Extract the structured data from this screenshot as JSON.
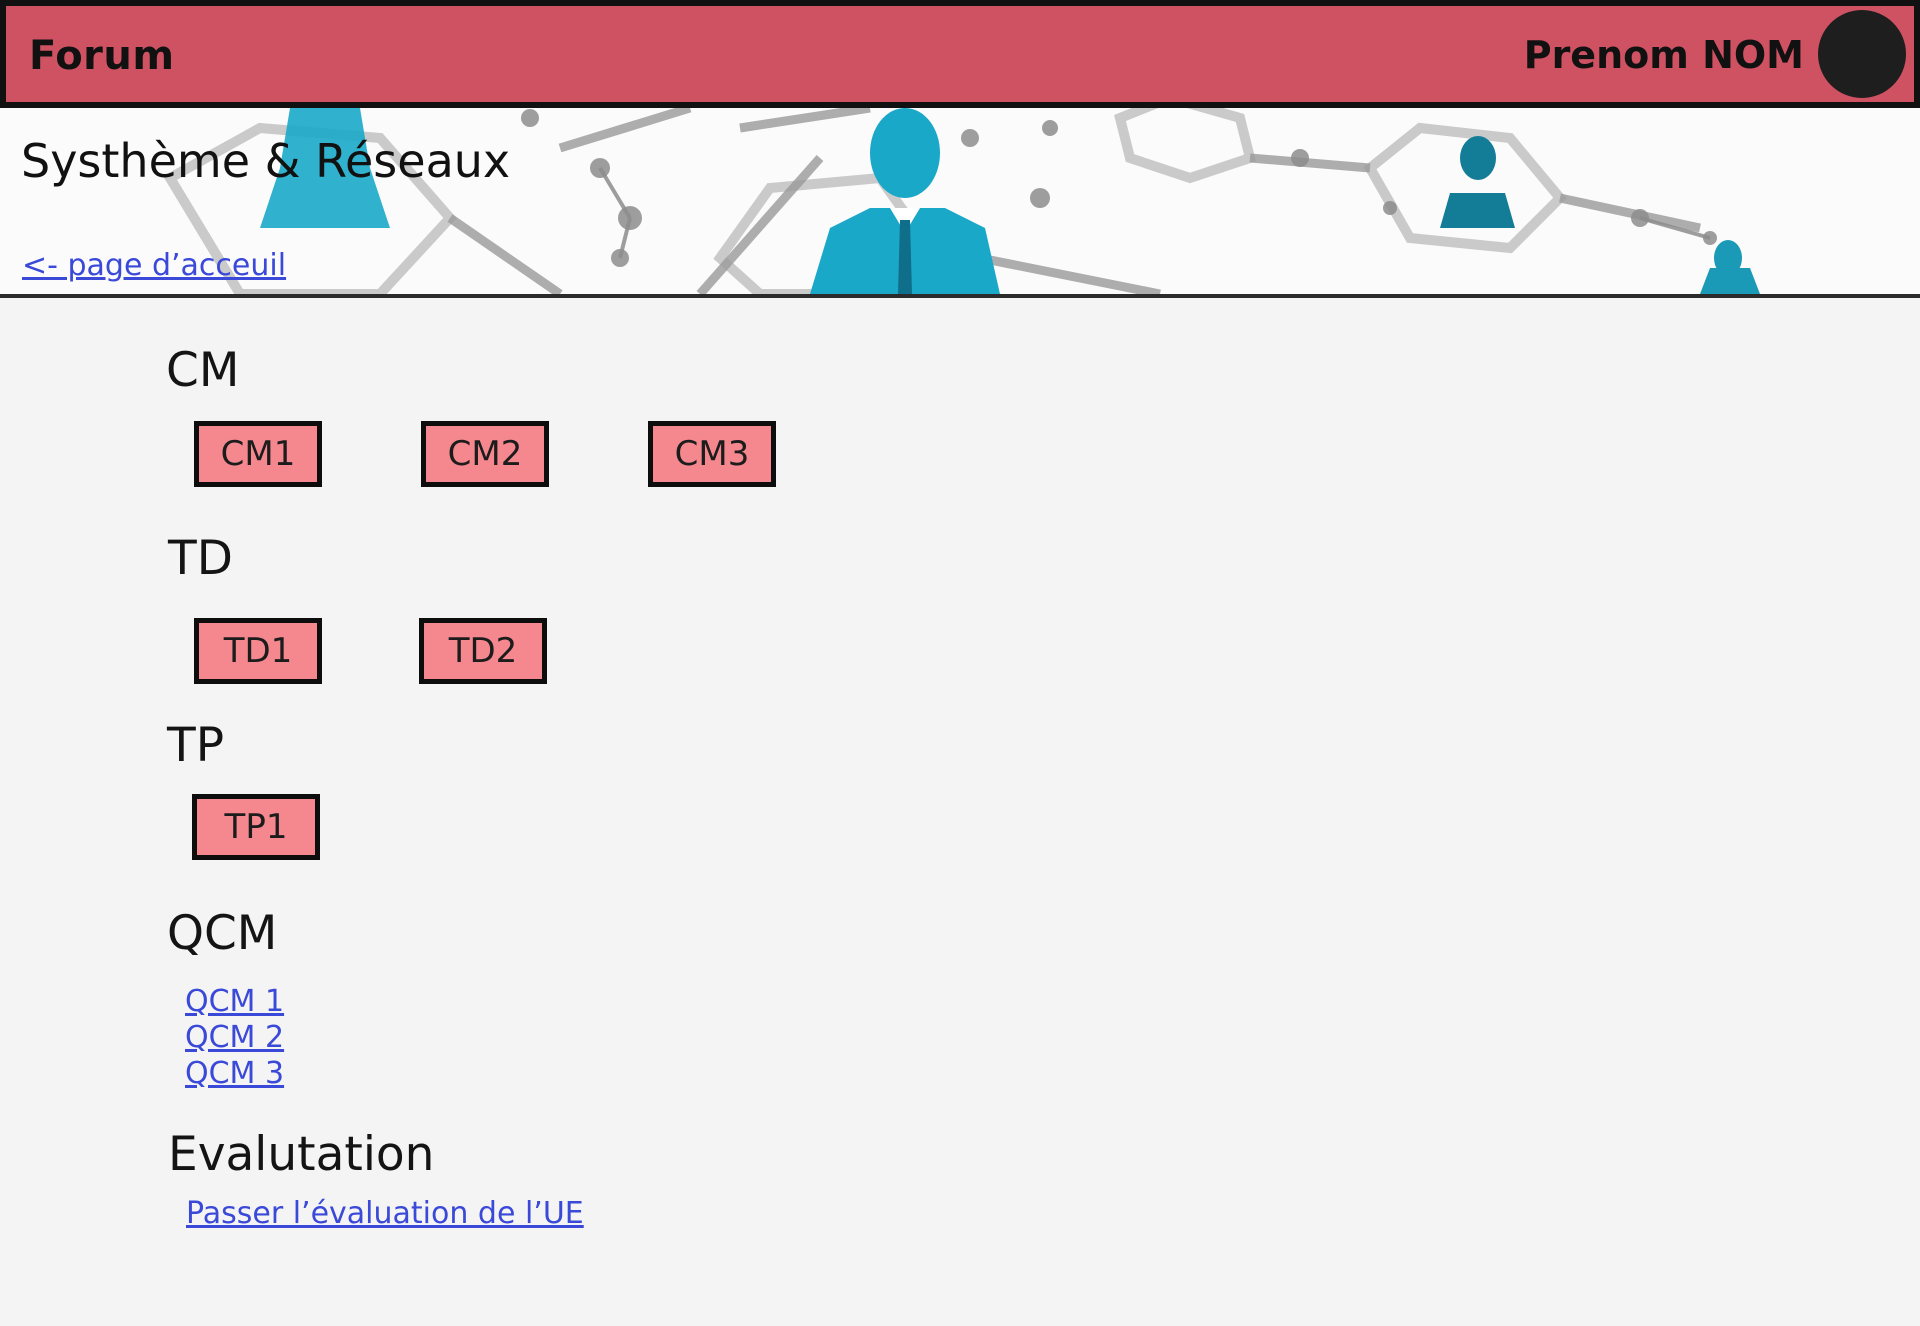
{
  "header": {
    "brand": "Forum",
    "user_name": "Prenom NOM"
  },
  "banner": {
    "course_title": "Systhème & Réseaux",
    "home_link": "<- page d’acceuil"
  },
  "sections": {
    "cm": {
      "heading": "CM",
      "items": [
        "CM1",
        "CM2",
        "CM3"
      ]
    },
    "td": {
      "heading": "TD",
      "items": [
        "TD1",
        "TD2"
      ]
    },
    "tp": {
      "heading": "TP",
      "items": [
        "TP1"
      ]
    },
    "qcm": {
      "heading": "QCM",
      "links": [
        "QCM 1",
        "QCM 2",
        "QCM 3"
      ]
    },
    "evaluation": {
      "heading": "Evalutation",
      "link": "Passer l’évaluation de l’UE"
    }
  },
  "colors": {
    "header_bg": "#cf5263",
    "tile_bg": "#f5888f",
    "link": "#3a49d8",
    "page_bg": "#f4f4f4"
  }
}
